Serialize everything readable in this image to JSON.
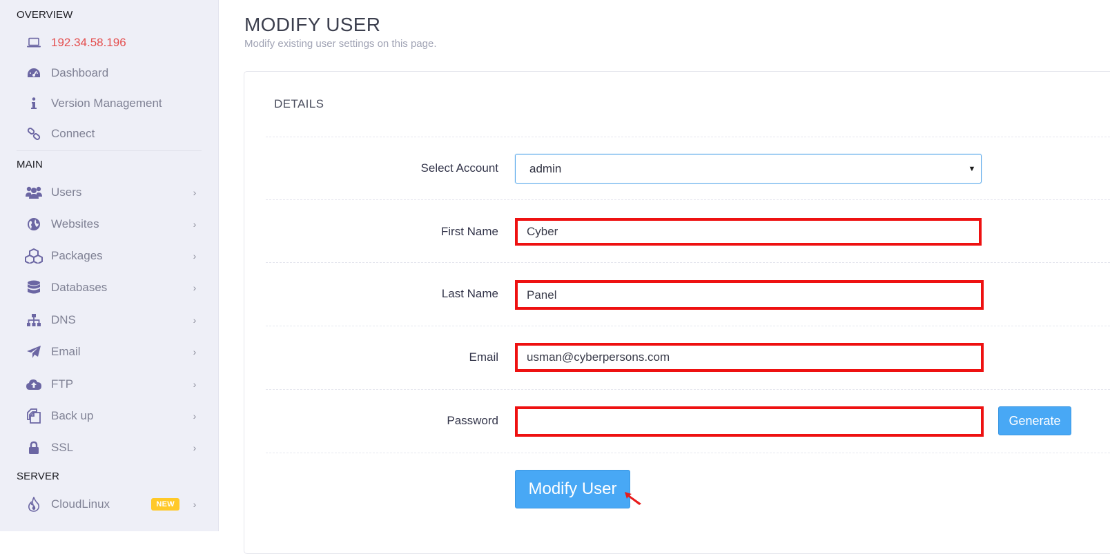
{
  "sidebar": {
    "sections": {
      "overview": "OVERVIEW",
      "main": "MAIN",
      "server": "SERVER"
    },
    "overview_items": [
      {
        "label": "192.34.58.196",
        "icon": "laptop-icon",
        "accent": true
      },
      {
        "label": "Dashboard",
        "icon": "dashboard-icon"
      },
      {
        "label": "Version Management",
        "icon": "info-icon"
      },
      {
        "label": "Connect",
        "icon": "link-icon"
      }
    ],
    "main_items": [
      {
        "label": "Users",
        "icon": "users-icon"
      },
      {
        "label": "Websites",
        "icon": "globe-icon"
      },
      {
        "label": "Packages",
        "icon": "cubes-icon"
      },
      {
        "label": "Databases",
        "icon": "database-icon"
      },
      {
        "label": "DNS",
        "icon": "sitemap-icon"
      },
      {
        "label": "Email",
        "icon": "paper-plane-icon"
      },
      {
        "label": "FTP",
        "icon": "cloud-upload-icon"
      },
      {
        "label": "Back up",
        "icon": "copy-icon"
      },
      {
        "label": "SSL",
        "icon": "lock-icon"
      }
    ],
    "server_items": [
      {
        "label": "CloudLinux",
        "icon": "flame-icon",
        "badge": "NEW"
      }
    ]
  },
  "header": {
    "title": "MODIFY USER",
    "subtitle": "Modify existing user settings on this page."
  },
  "form": {
    "section_title": "DETAILS",
    "select_account": {
      "label": "Select Account",
      "value": "admin"
    },
    "first_name": {
      "label": "First Name",
      "value": "Cyber"
    },
    "last_name": {
      "label": "Last Name",
      "value": "Panel"
    },
    "email": {
      "label": "Email",
      "value": "usman@cyberpersons.com"
    },
    "password": {
      "label": "Password",
      "value": ""
    },
    "generate_label": "Generate",
    "submit_label": "Modify User"
  },
  "colors": {
    "accent_red": "#e44e4e",
    "primary_blue": "#48a8f5",
    "highlight_red": "#ee1111",
    "badge_yellow": "#ffc928",
    "icon_purple": "#6b66a3"
  }
}
